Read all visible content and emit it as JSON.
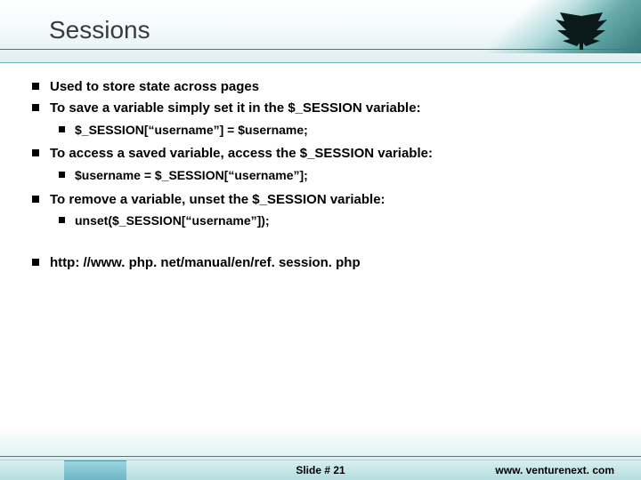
{
  "header": {
    "title": "Sessions"
  },
  "bullets": {
    "b1": "Used to store state across pages",
    "b2": "To save a variable simply set it in the $_SESSION variable:",
    "b2a": "$_SESSION[“username”] = $username;",
    "b3": "To access a saved variable, access the $_SESSION variable:",
    "b3a": "$username = $_SESSION[“username”];",
    "b4": "To remove a variable, unset the $_SESSION variable:",
    "b4a": "unset($_SESSION[“username”]);",
    "b5": "http: //www. php. net/manual/en/ref. session. php"
  },
  "footer": {
    "slide_label": "Slide # 21",
    "site": "www. venturenext. com"
  },
  "colors": {
    "accent": "#2a8a89"
  }
}
